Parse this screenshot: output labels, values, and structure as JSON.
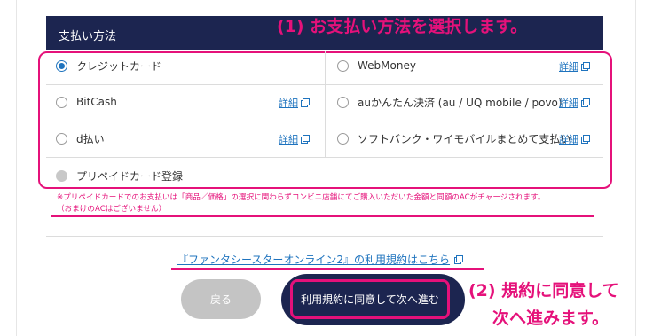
{
  "header": {
    "title": "支払い方法"
  },
  "annotations": {
    "step1": "(1) お支払い方法を選択します。",
    "step2_line1": "(2) 規約に同意して",
    "step2_line2": "次へ進みます。"
  },
  "payment_options": [
    {
      "label": "クレジットカード",
      "selected": true
    },
    {
      "label": "WebMoney",
      "detail": "詳細"
    },
    {
      "label": "BitCash",
      "detail": "詳細"
    },
    {
      "label": "auかんたん決済 (au / UQ mobile / povo)",
      "detail": "詳細"
    },
    {
      "label": "d払い",
      "detail": "詳細"
    },
    {
      "label": "ソフトバンク・ワイモバイルまとめて支払い",
      "detail": "詳細"
    },
    {
      "label": "プリペイドカード登録",
      "disabled": true
    }
  ],
  "notice": {
    "line1": "※プリペイドカードでのお支払いは「商品／価格」の選択に関わらずコンビニ店舗にてご購入いただいた金額と同額のACがチャージされます。",
    "line2": "（おまけのACはございません）"
  },
  "terms_link": "『ファンタシースターオンライン2』の利用規約はこちら",
  "buttons": {
    "back": "戻る",
    "next": "利用規約に同意して次へ進む"
  },
  "colors": {
    "navy": "#1c2550",
    "highlight": "#e5117a",
    "link": "#1e73be"
  },
  "icons": {
    "external": "external-link-icon"
  }
}
